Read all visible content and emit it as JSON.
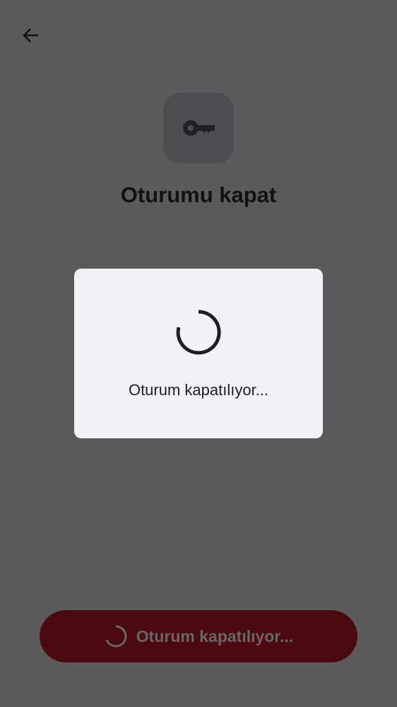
{
  "header": {
    "back_icon": "arrow-left-icon"
  },
  "hero": {
    "icon": "key-icon",
    "title": "Oturumu kapat"
  },
  "dialog": {
    "icon": "spinner-icon",
    "message": "Oturum kapatılıyor..."
  },
  "button": {
    "icon": "spinner-icon",
    "label": "Oturum kapatılıyor..."
  },
  "colors": {
    "background": "#5b5b5b",
    "dialog": "#f0f2f6",
    "button": "#4a0a10"
  }
}
